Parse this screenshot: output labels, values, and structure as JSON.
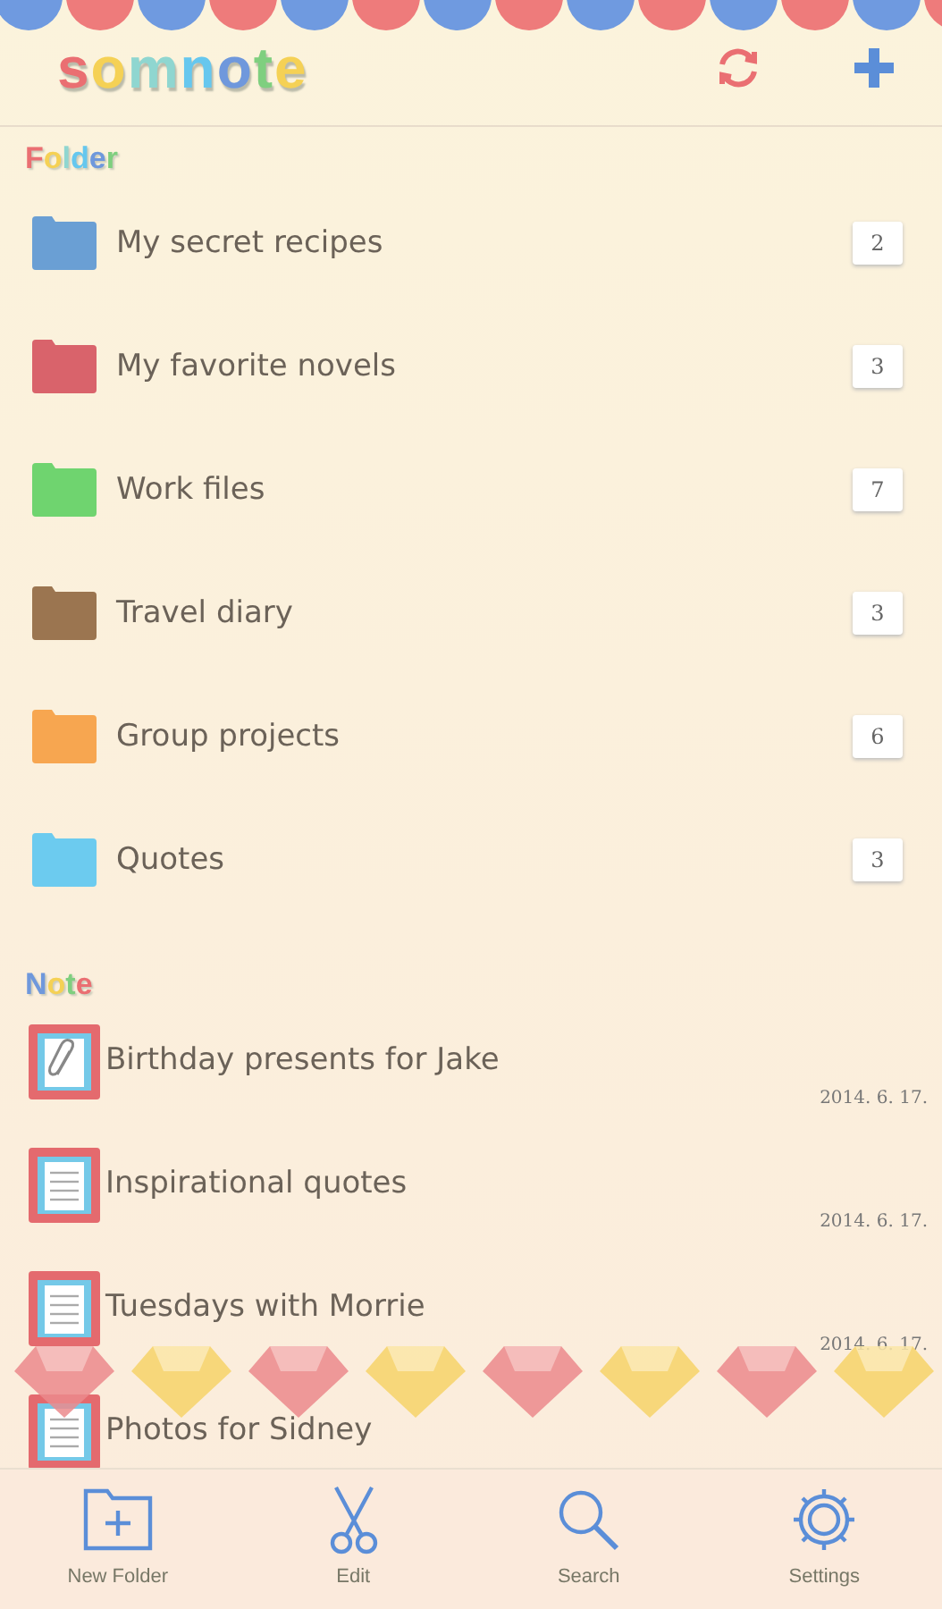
{
  "header": {
    "logo": "somnote"
  },
  "folder_section": {
    "title": "Folder",
    "folders": [
      {
        "name": "My secret recipes",
        "count": "2",
        "color": "#6a9fd4"
      },
      {
        "name": "My favorite novels",
        "count": "3",
        "color": "#d9636b"
      },
      {
        "name": "Work files",
        "count": "7",
        "color": "#6fd46f"
      },
      {
        "name": "Travel diary",
        "count": "3",
        "color": "#9b7550"
      },
      {
        "name": "Group projects",
        "count": "6",
        "color": "#f7a650"
      },
      {
        "name": "Quotes",
        "count": "3",
        "color": "#6ccbef"
      }
    ]
  },
  "note_section": {
    "title": "Note",
    "notes": [
      {
        "title": "Birthday presents for Jake",
        "date": "2014. 6. 17.",
        "kind": "attachment"
      },
      {
        "title": "Inspirational quotes",
        "date": "2014. 6. 17.",
        "kind": "list"
      },
      {
        "title": "Tuesdays with Morrie",
        "date": "2014. 6. 17.",
        "kind": "list"
      },
      {
        "title": "Photos for Sidney",
        "kind": "list"
      }
    ]
  },
  "tab_bar": [
    {
      "label": "New Folder",
      "kind": "new-folder"
    },
    {
      "label": "Edit",
      "kind": "edit"
    },
    {
      "label": "Search",
      "kind": "search"
    },
    {
      "label": "Settings",
      "kind": "settings"
    }
  ]
}
